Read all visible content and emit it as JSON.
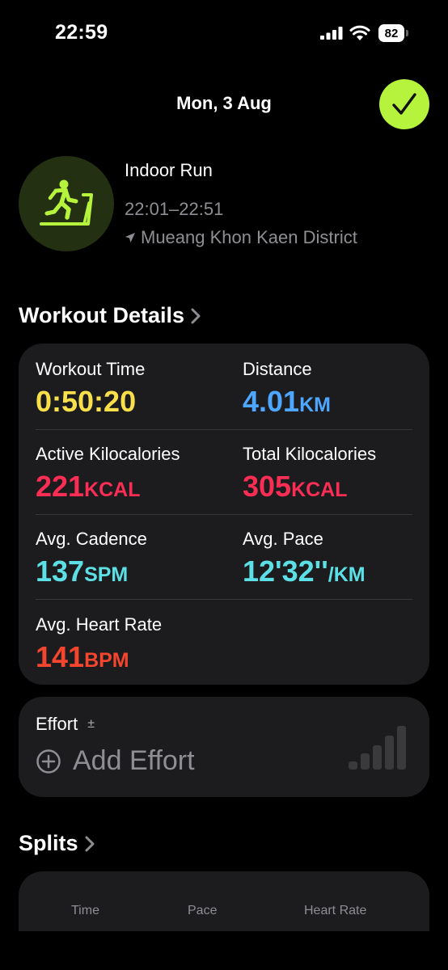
{
  "status_bar": {
    "time": "22:59",
    "battery": "82"
  },
  "header": {
    "date": "Mon, 3 Aug",
    "done_icon": "checkmark-icon",
    "accent": "#b6f33c"
  },
  "workout": {
    "icon": "treadmill-runner-icon",
    "title": "Indoor Run",
    "time_range": "22:01–22:51",
    "location": "Mueang Khon Kaen District"
  },
  "details": {
    "title": "Workout Details",
    "metrics": [
      {
        "label": "Workout Time",
        "value": "0:50:20",
        "unit": "",
        "color": "#f9df4a"
      },
      {
        "label": "Distance",
        "value": "4.01",
        "unit": "KM",
        "color": "#4da6ff"
      },
      {
        "label": "Active Kilocalories",
        "value": "221",
        "unit": "KCAL",
        "color": "#fa2d55"
      },
      {
        "label": "Total Kilocalories",
        "value": "305",
        "unit": "KCAL",
        "color": "#fa2d55"
      },
      {
        "label": "Avg. Cadence",
        "value": "137",
        "unit": "SPM",
        "color": "#5ce0e6"
      },
      {
        "label": "Avg. Pace",
        "value": "12'32''",
        "unit": "/KM",
        "color": "#5ce0e6"
      },
      {
        "label": "Avg. Heart Rate",
        "value": "141",
        "unit": "BPM",
        "color": "#f4452e"
      }
    ]
  },
  "effort": {
    "label": "Effort",
    "pm_symbol": "±",
    "add_label": "Add Effort"
  },
  "splits": {
    "title": "Splits",
    "columns": [
      "Time",
      "Pace",
      "Heart Rate"
    ]
  }
}
